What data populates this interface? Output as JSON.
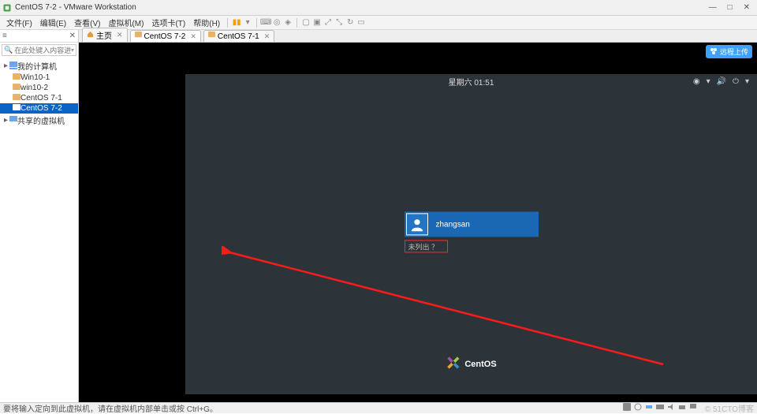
{
  "title": "CentOS 7-2 - VMware Workstation",
  "win_controls": {
    "min": "—",
    "max": "□",
    "close": "✕"
  },
  "menus": [
    {
      "label": "文件(F)"
    },
    {
      "label": "编辑(E)"
    },
    {
      "label": "查看(V)"
    },
    {
      "label": "虚拟机(M)"
    },
    {
      "label": "选项卡(T)"
    },
    {
      "label": "帮助(H)"
    }
  ],
  "sidebar": {
    "search_placeholder": "在此处键入内容进行搜索",
    "root": "我的计算机",
    "items": [
      {
        "label": "Win10-1"
      },
      {
        "label": "win10-2"
      },
      {
        "label": "CentOS 7-1"
      },
      {
        "label": "CentOS 7-2",
        "selected": true
      }
    ],
    "shared": "共享的虚拟机"
  },
  "tabs": [
    {
      "label": "主页",
      "kind": "home",
      "active": false
    },
    {
      "label": "CentOS 7-2",
      "kind": "vm",
      "active": true
    },
    {
      "label": "CentOS 7-1",
      "kind": "vm",
      "active": false
    }
  ],
  "vm": {
    "clock": "星期六 01:51",
    "user": "zhangsan",
    "not_listed": "未列出 ？",
    "brand": "CentOS",
    "badge": "远程上传"
  },
  "status": {
    "hint": "要将输入定向到此虚拟机，请在虚拟机内部单击或按 Ctrl+G。",
    "watermark": "© 51CTO博客"
  }
}
